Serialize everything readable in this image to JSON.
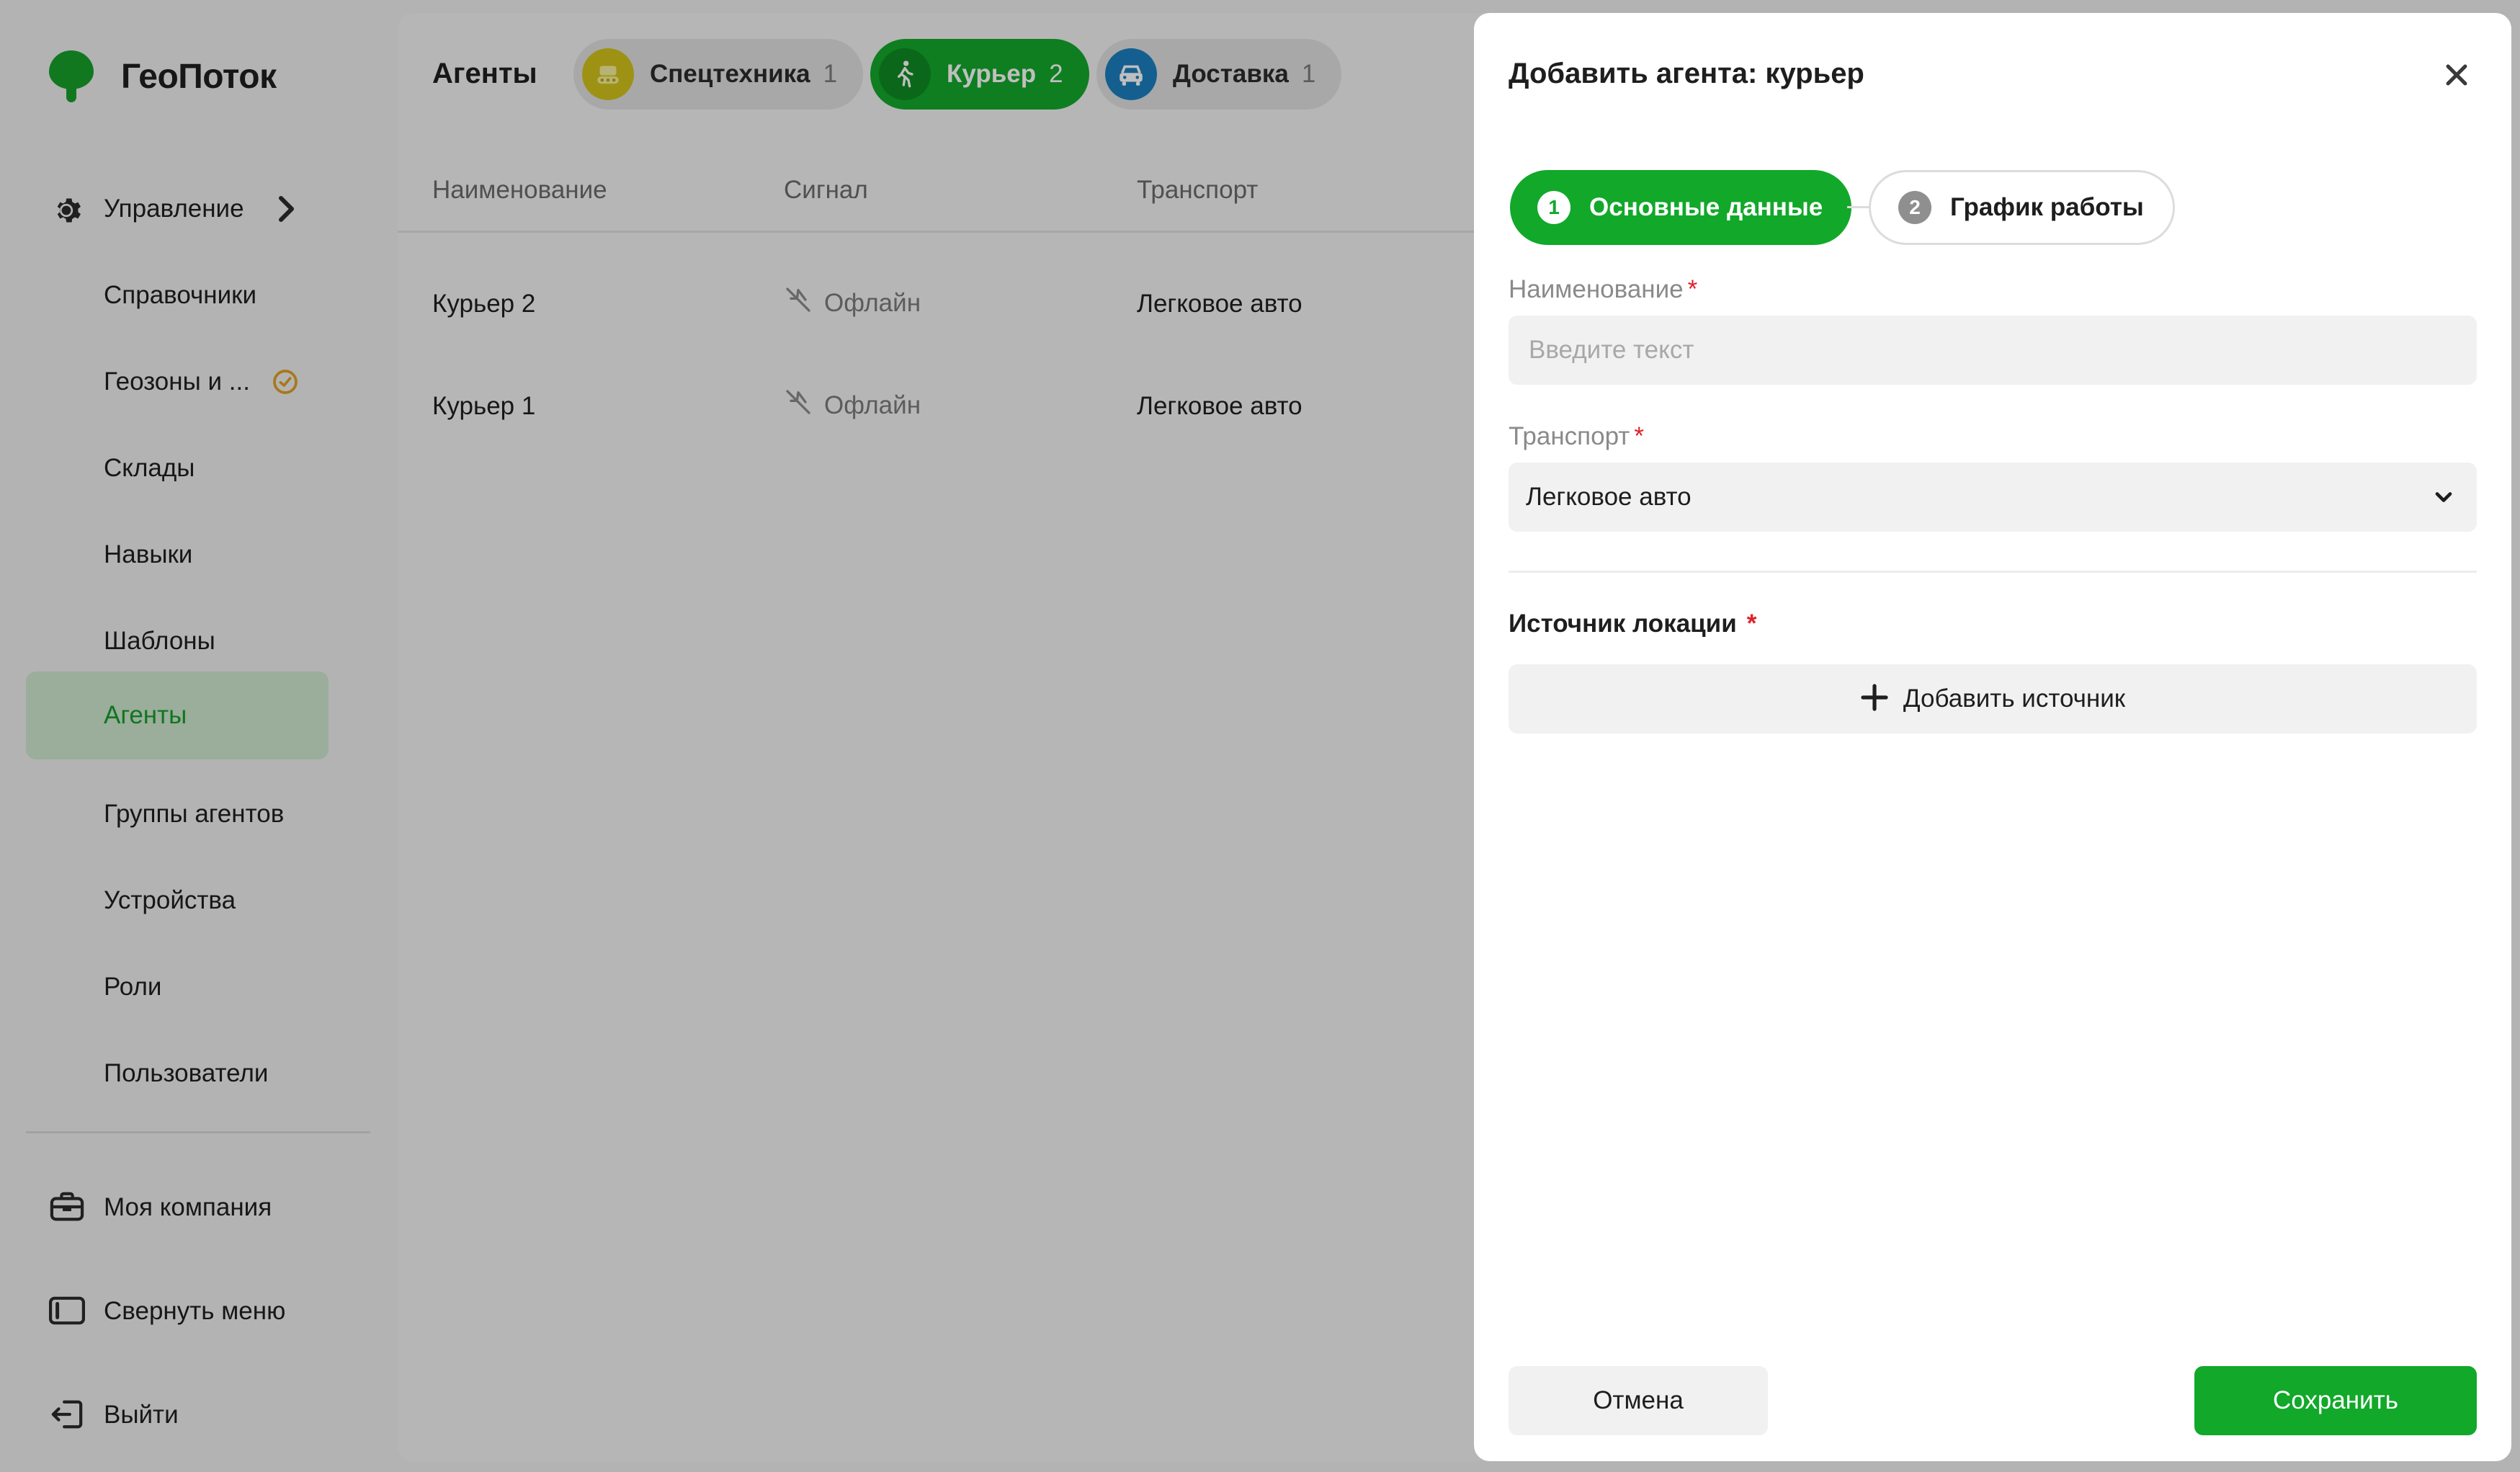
{
  "app": {
    "name": "ГеоПоток",
    "brand_color": "#12a82a"
  },
  "sidebar": {
    "section": {
      "label": "Управление",
      "icon": "gear-icon"
    },
    "items": [
      {
        "label": "Справочники"
      },
      {
        "label": "Геозоны и ...",
        "badge_icon": "clock-check-icon",
        "badge_color": "#e0a020"
      },
      {
        "label": "Склады"
      },
      {
        "label": "Навыки"
      },
      {
        "label": "Шаблоны"
      },
      {
        "label": "Агенты",
        "active": true
      },
      {
        "label": "Группы агентов"
      },
      {
        "label": "Устройства"
      },
      {
        "label": "Роли"
      },
      {
        "label": "Пользователи"
      }
    ],
    "footer": [
      {
        "label": "Моя компания",
        "icon": "briefcase-icon"
      },
      {
        "label": "Свернуть меню",
        "icon": "sidebar-collapse-icon"
      },
      {
        "label": "Выйти",
        "icon": "logout-icon"
      }
    ]
  },
  "main": {
    "title": "Агенты",
    "chips": [
      {
        "label": "Спецтехника",
        "count": "1",
        "icon": "excavator-icon",
        "icon_color": "#d1c21a",
        "active": false
      },
      {
        "label": "Курьер",
        "count": "2",
        "icon": "walking-person-icon",
        "icon_color": "#0e8a22",
        "active": true
      },
      {
        "label": "Доставка",
        "count": "1",
        "icon": "car-icon",
        "icon_color": "#1a7fbf",
        "active": false
      }
    ],
    "columns": [
      "Наименование",
      "Сигнал",
      "Транспорт"
    ],
    "rows": [
      {
        "name": "Курьер 2",
        "signal": "Офлайн",
        "transport": "Легковое авто"
      },
      {
        "name": "Курьер 1",
        "signal": "Офлайн",
        "transport": "Легковое авто"
      }
    ]
  },
  "drawer": {
    "title": "Добавить агента: курьер",
    "steps": [
      {
        "num": "1",
        "label": "Основные данные",
        "active": true
      },
      {
        "num": "2",
        "label": "График работы",
        "active": false
      }
    ],
    "name_field": {
      "label": "Наименование",
      "required_mark": "*",
      "placeholder": "Введите текст",
      "value": ""
    },
    "transport_field": {
      "label": "Транспорт",
      "required_mark": "*",
      "value": "Легковое авто"
    },
    "location_section": {
      "title": "Источник локации",
      "required_mark": "*",
      "add_label": "Добавить источник"
    },
    "cancel_label": "Отмена",
    "save_label": "Сохранить"
  }
}
